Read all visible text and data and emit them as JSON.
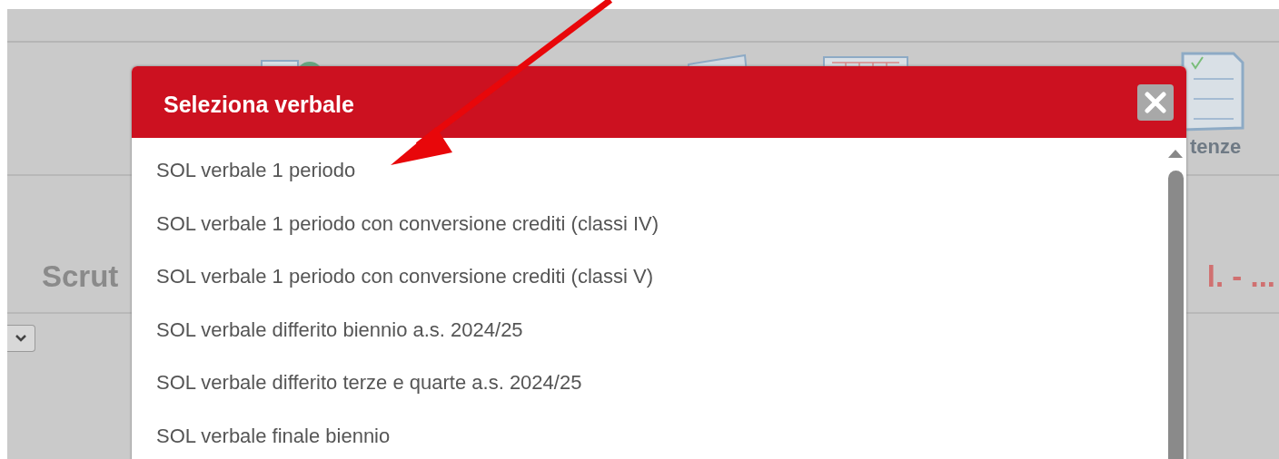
{
  "background": {
    "toolbar_label": "tenze",
    "heading": "Scrut",
    "heading_right": "l. - ..."
  },
  "dialog": {
    "title": "Seleziona verbale",
    "items": [
      {
        "label": "SOL verbale 1 periodo"
      },
      {
        "label": "SOL verbale 1 periodo con conversione crediti (classi IV)"
      },
      {
        "label": "SOL verbale 1 periodo con conversione crediti (classi V)"
      },
      {
        "label": "SOL verbale differito biennio a.s. 2024/25"
      },
      {
        "label": "SOL verbale differito terze e quarte a.s. 2024/25"
      },
      {
        "label": "SOL verbale finale biennio"
      }
    ]
  }
}
